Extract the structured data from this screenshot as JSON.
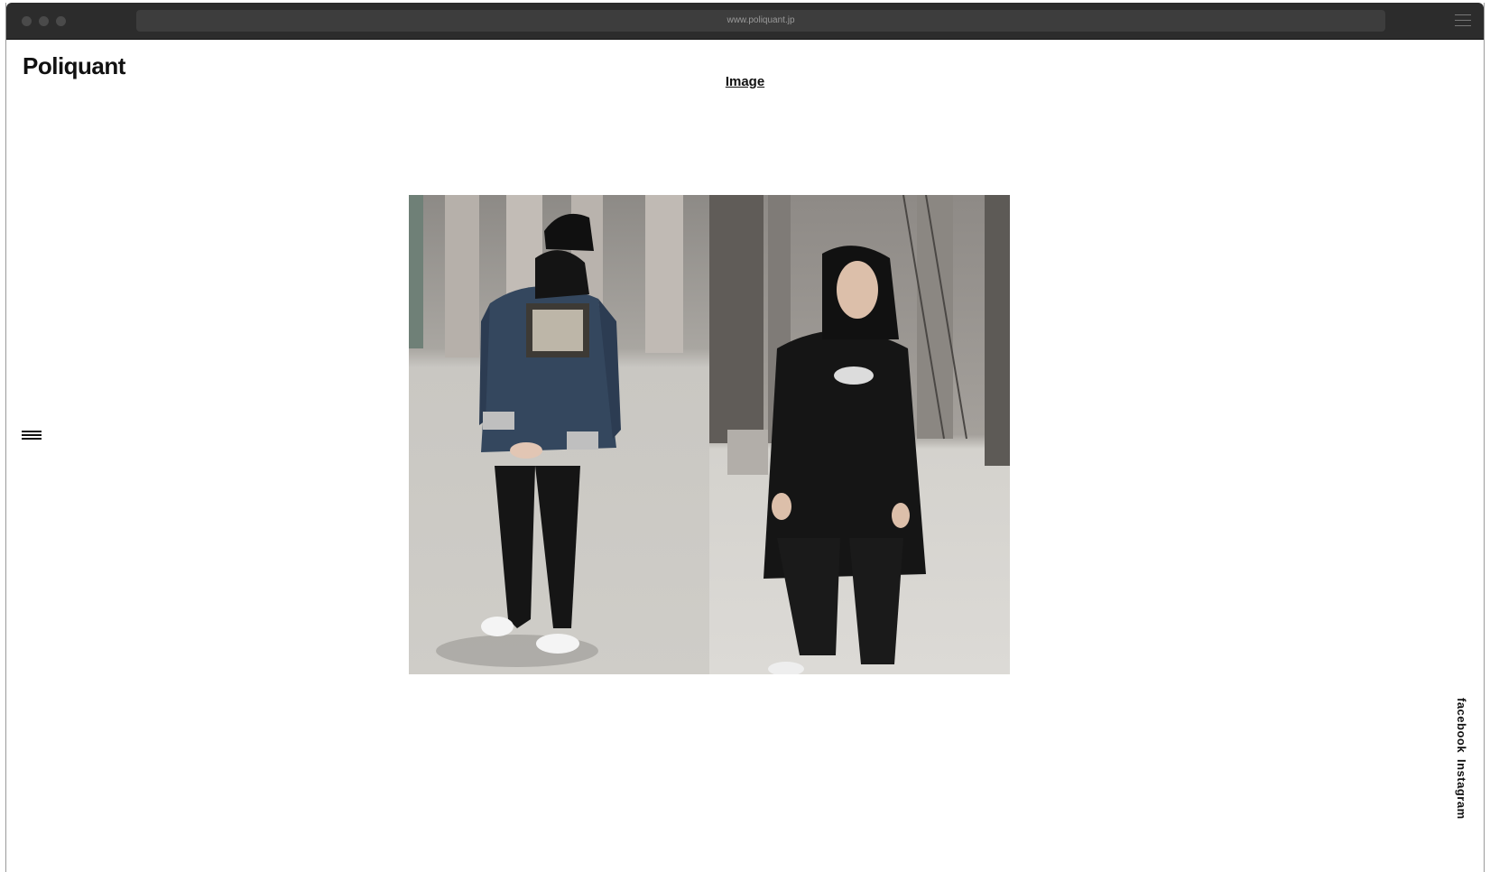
{
  "browser": {
    "url": "www.poliquant.jp"
  },
  "site": {
    "logo": "Poliquant"
  },
  "nav": {
    "current": "Image"
  },
  "gallery": {
    "photos": [
      {
        "name": "model-back-denim-jacket"
      },
      {
        "name": "model-front-black-bomber"
      }
    ]
  },
  "social": {
    "facebook": "facebook",
    "instagram": "Instagram"
  },
  "colors": {
    "titlebar": "#2c2c2c",
    "text": "#111111"
  }
}
